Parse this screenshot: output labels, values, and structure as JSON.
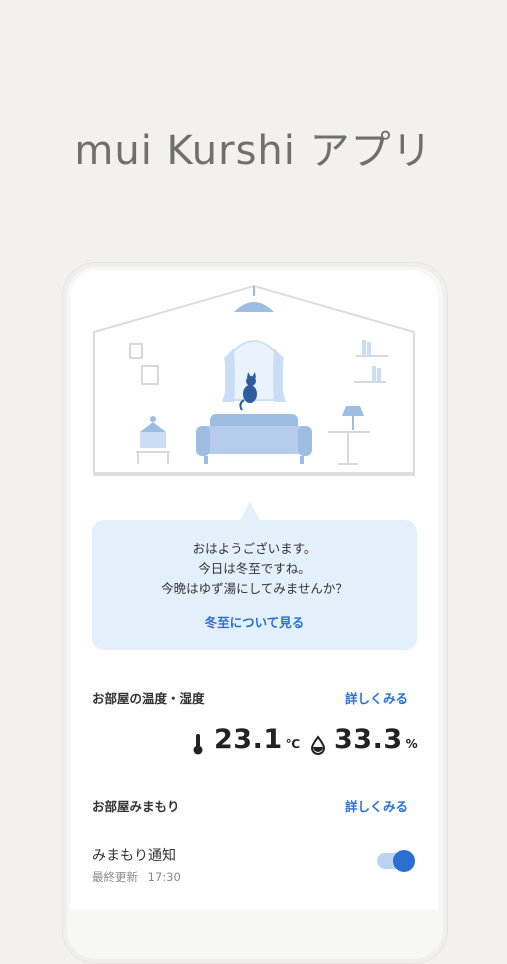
{
  "hero": {
    "title": "mui Kurshi アプリ"
  },
  "message": {
    "lines": [
      "おはようございます。",
      "今日は冬至ですね。",
      "今晩はゆず湯にしてみませんか？"
    ],
    "link": "冬至について見る"
  },
  "environment": {
    "title": "お部屋の温度・湿度",
    "detail_label": "詳しくみる",
    "temperature": {
      "value": "23.1",
      "unit": "℃",
      "icon": "thermometer-icon"
    },
    "humidity": {
      "value": "33.3",
      "unit": "%",
      "icon": "droplet-icon"
    }
  },
  "watch": {
    "title": "お部屋みまもり",
    "detail_label": "詳しくみる",
    "notice_label": "みまもり通知",
    "last_updated_label": "最終更新",
    "last_updated_time": "17:30",
    "enabled": true
  },
  "colors": {
    "accent": "#2a6fd1",
    "bubble": "#e3f0fb",
    "illustration": "#9dbde3"
  }
}
